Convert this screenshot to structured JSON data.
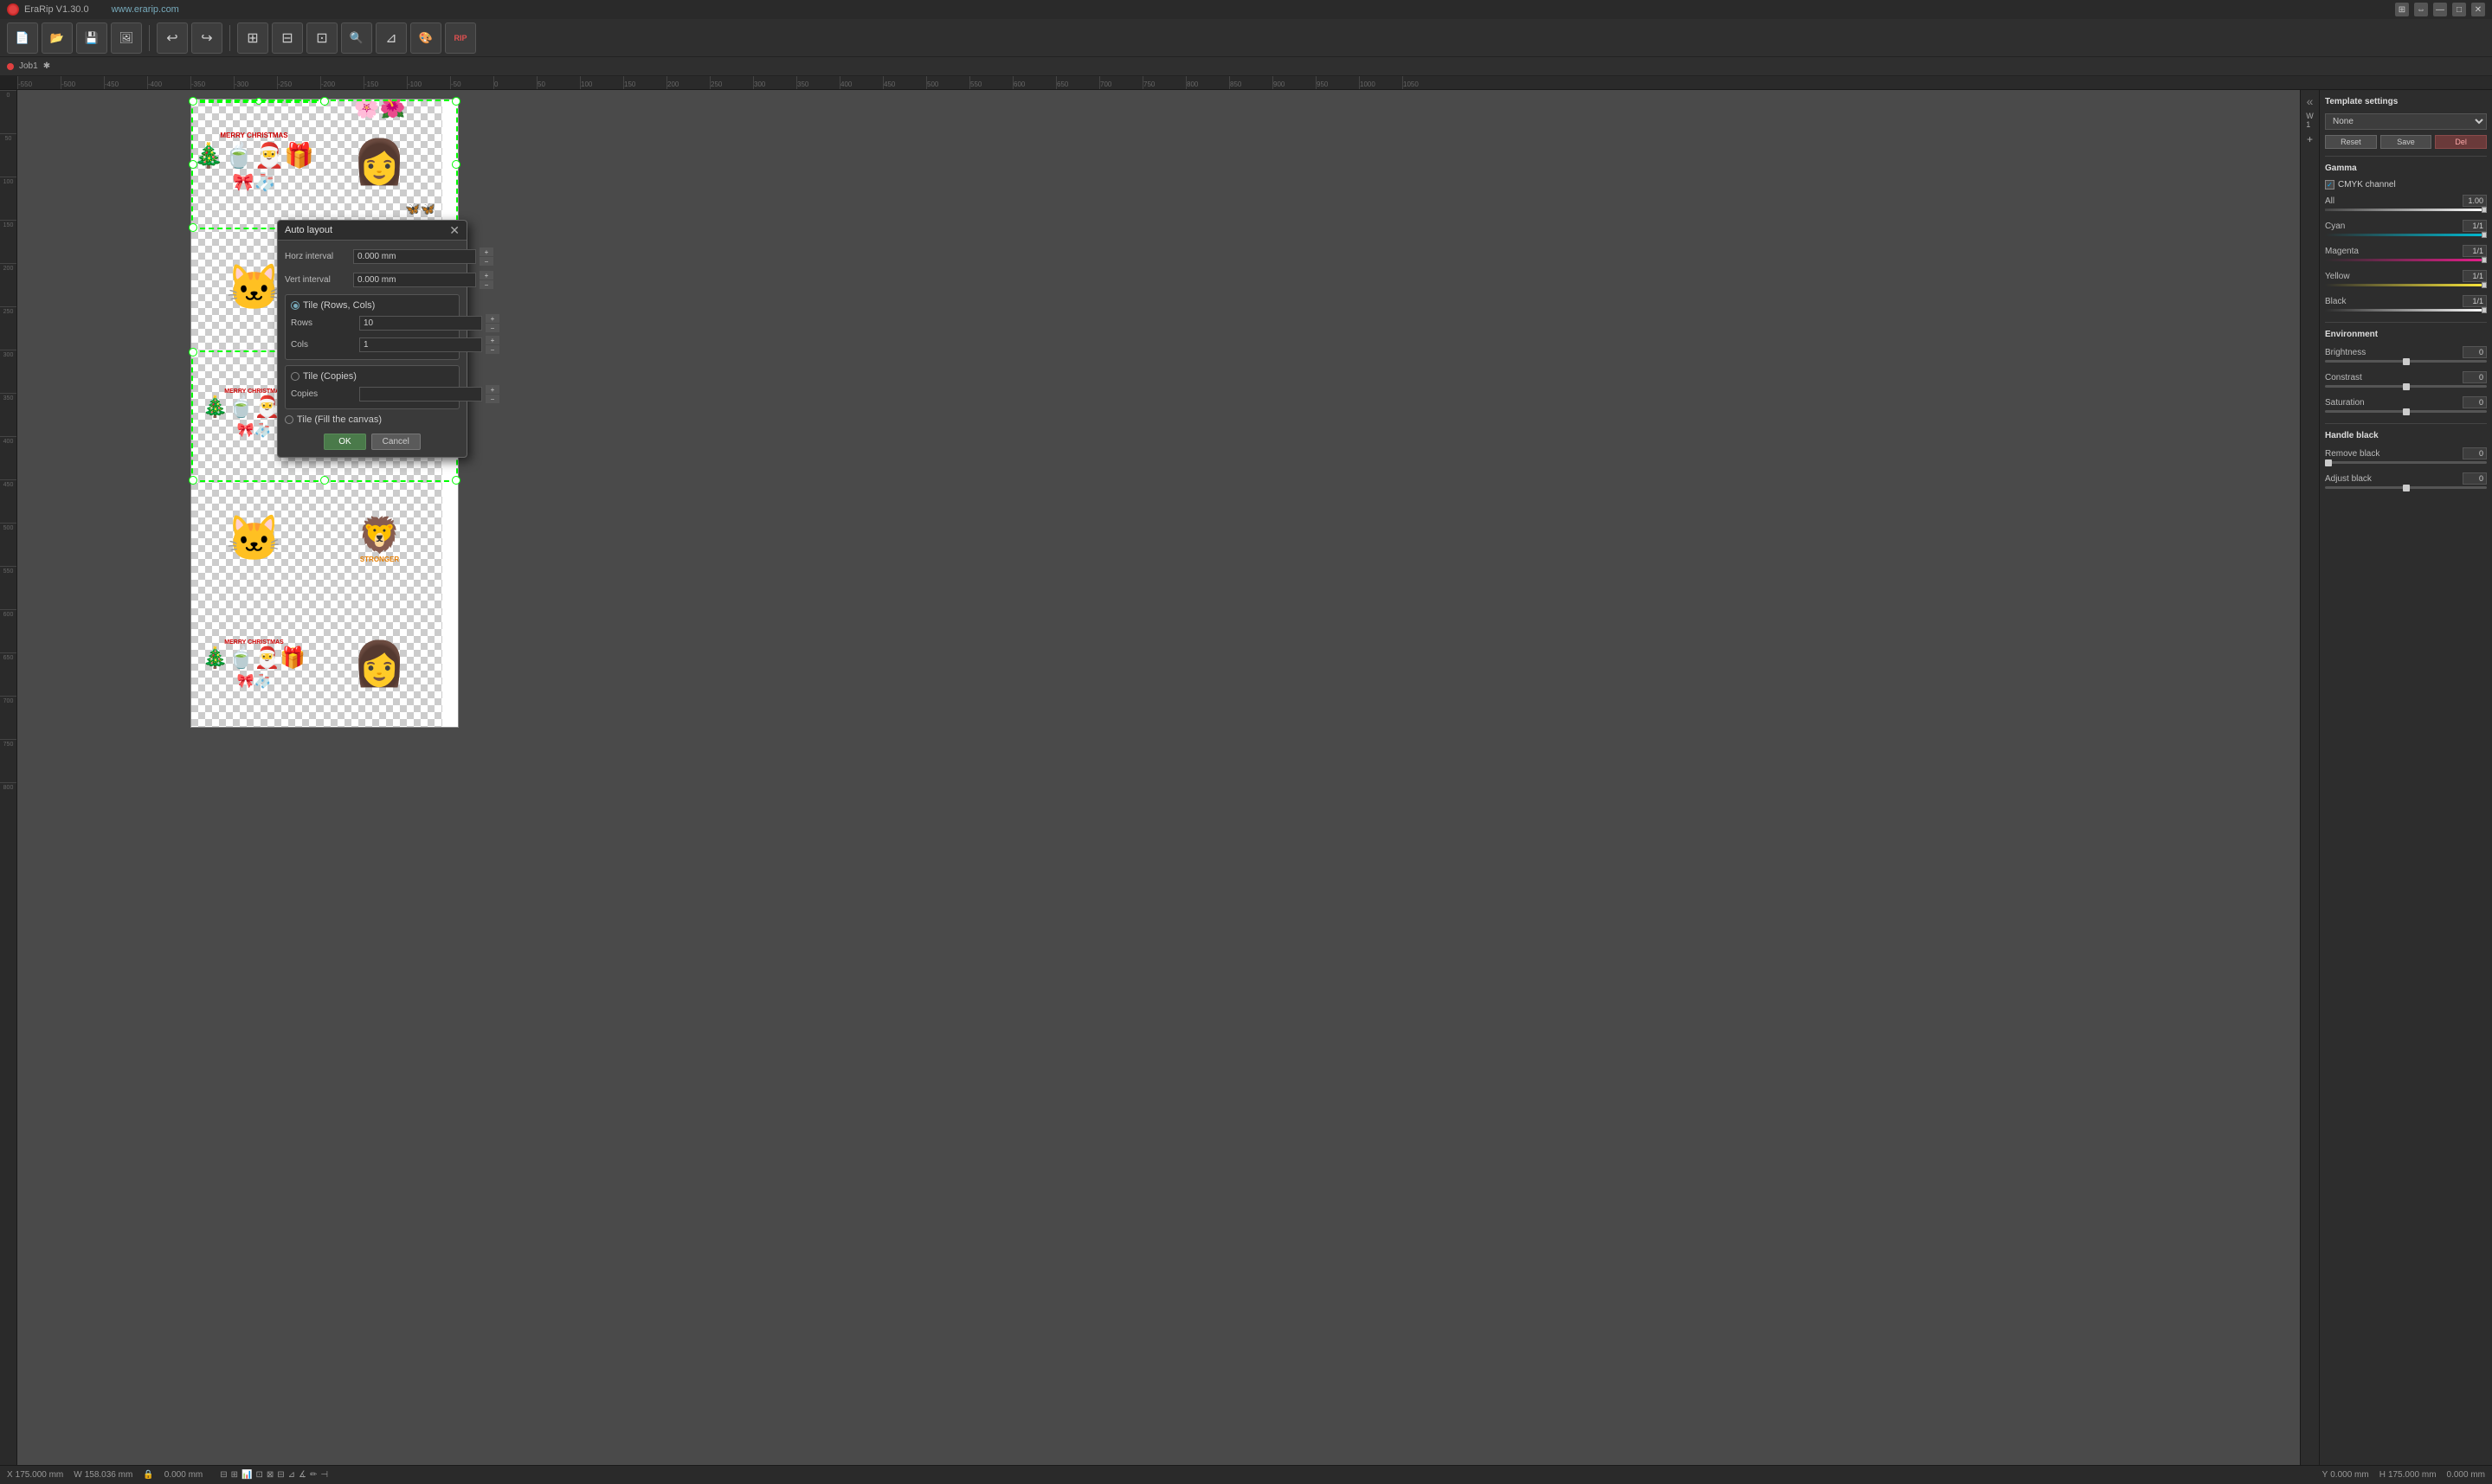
{
  "app": {
    "title": "EraRip V1.30.0",
    "website": "www.erarip.com"
  },
  "titlebar": {
    "title": "EraRip V1.30.0",
    "website_label": "www.erarip.com",
    "minimize_label": "—",
    "maximize_label": "□",
    "close_label": "✕",
    "grid_label": "⊞",
    "pin_label": "⇔"
  },
  "toolbar": {
    "tools": [
      {
        "name": "new",
        "icon": "📄",
        "label": "New"
      },
      {
        "name": "open",
        "icon": "📂",
        "label": "Open"
      },
      {
        "name": "save",
        "icon": "💾",
        "label": "Save"
      },
      {
        "name": "image",
        "icon": "🖼",
        "label": "Image"
      },
      {
        "name": "undo",
        "icon": "↩",
        "label": "Undo"
      },
      {
        "name": "redo",
        "icon": "↪",
        "label": "Redo"
      },
      {
        "name": "grid-view",
        "icon": "⊞",
        "label": "Grid View"
      },
      {
        "name": "align",
        "icon": "⊟",
        "label": "Align"
      },
      {
        "name": "crop",
        "icon": "⊡",
        "label": "Crop"
      },
      {
        "name": "search",
        "icon": "🔍",
        "label": "Search"
      },
      {
        "name": "selection",
        "icon": "⊿",
        "label": "Selection"
      },
      {
        "name": "color",
        "icon": "🎨",
        "label": "Color"
      },
      {
        "name": "rip",
        "icon": "RIP",
        "label": "RIP"
      }
    ]
  },
  "jobbar": {
    "job_name": "Job1",
    "x_label": "X",
    "x_value": "175.000 mm",
    "y_label": "Y",
    "y_value": "0.000 mm",
    "w_label": "W",
    "w_value": "158.036 mm",
    "h_label": "H",
    "h_value": "175.000 mm",
    "angle1": "0.000 mm",
    "angle2": "0.000 mm"
  },
  "ruler": {
    "h_marks": [
      "-550",
      "-500",
      "-450",
      "-400",
      "-350",
      "-300",
      "-250",
      "-200",
      "-150",
      "-100",
      "-50",
      "0",
      "50",
      "100",
      "150",
      "200",
      "250",
      "300",
      "350",
      "400",
      "450",
      "500",
      "550",
      "600",
      "650",
      "700",
      "750",
      "800",
      "850",
      "900",
      "950",
      "1000",
      "1050"
    ],
    "v_marks": [
      "0",
      "50",
      "100",
      "150",
      "200",
      "250",
      "300",
      "350",
      "400",
      "450",
      "500",
      "550",
      "600",
      "650",
      "700",
      "750",
      "800"
    ]
  },
  "canvas": {
    "designs": [
      {
        "id": "xmas1",
        "icon": "🎄🎁",
        "row": 0,
        "col": 0,
        "label": "Christmas"
      },
      {
        "id": "woman1",
        "icon": "👩🌸",
        "row": 0,
        "col": 1,
        "label": "Woman"
      },
      {
        "id": "cat1",
        "icon": "🐱",
        "row": 1,
        "col": 0,
        "label": "Cat"
      },
      {
        "id": "lion1",
        "icon": "🦁",
        "row": 1,
        "col": 1,
        "label": "Lion Dance"
      },
      {
        "id": "xmas2",
        "icon": "🎄🎁",
        "row": 2,
        "col": 0,
        "label": "Christmas"
      },
      {
        "id": "woman2",
        "icon": "👩🌸",
        "row": 2,
        "col": 1,
        "label": "Woman"
      },
      {
        "id": "cat2",
        "icon": "🐱",
        "row": 3,
        "col": 0,
        "label": "Cat"
      },
      {
        "id": "lion2",
        "icon": "🦁",
        "row": 3,
        "col": 1,
        "label": "Lion Dance"
      },
      {
        "id": "xmas3",
        "icon": "🎄🎁",
        "row": 4,
        "col": 0,
        "label": "Christmas"
      },
      {
        "id": "woman3",
        "icon": "👩🌸",
        "row": 4,
        "col": 1,
        "label": "Woman"
      }
    ]
  },
  "autolayout_dialog": {
    "title": "Auto layout",
    "horz_interval_label": "Horz interval",
    "horz_interval_value": "0.000 mm",
    "vert_interval_label": "Vert interval",
    "vert_interval_value": "0.000 mm",
    "tile_rows_cols_label": "Tile (Rows, Cols)",
    "rows_label": "Rows",
    "rows_value": "10",
    "cols_label": "Cols",
    "cols_value": "1",
    "tile_copies_label": "Tile (Copies)",
    "copies_label": "Copies",
    "tile_fill_label": "Tile (Fill the canvas)",
    "ok_label": "OK",
    "cancel_label": "Cancel",
    "active_option": "rows_cols"
  },
  "settings_panel": {
    "template_settings_label": "Template settings",
    "template_dropdown_value": "None",
    "reset_label": "Reset",
    "save_label": "Save",
    "del_label": "Del",
    "gamma_label": "Gamma",
    "cmyk_channel_label": "CMYK channel",
    "all_label": "All",
    "all_value": "1.00",
    "cyan_label": "Cyan",
    "cyan_value": "1/1",
    "magenta_label": "Magenta",
    "magenta_value": "1/1",
    "yellow_label": "Yellow",
    "yellow_value": "1/1",
    "black_label": "Black",
    "black_value": "1/1",
    "environment_label": "Environment",
    "brightness_label": "Brightness",
    "brightness_value": "0",
    "contrast_label": "Constrast",
    "contrast_value": "0",
    "saturation_label": "Saturation",
    "saturation_value": "0",
    "handle_black_label": "Handle black",
    "remove_black_label": "Remove black",
    "remove_black_value": "0",
    "adjust_black_label": "Adjust black",
    "adjust_black_value": "0"
  },
  "right_icons": {
    "expand_label": "«»",
    "w_label": "W",
    "one_label": "1",
    "plus_label": "+"
  },
  "status_bar": {
    "x_label": "X",
    "x_value": "175.000 mm",
    "y_label": "Y",
    "y_value": "0.000 mm",
    "w_label": "W",
    "w_value": "158.036 mm",
    "h_label": "H",
    "h_value": "175.000 mm",
    "lock_icon": "🔒",
    "angle1": "0.000 mm",
    "angle2": "0.000 mm",
    "icons_row": [
      "⊟",
      "⊞",
      "📊",
      "⊡",
      "⊠",
      "⊟",
      "⊿",
      "∡",
      "✏",
      "⊣"
    ]
  }
}
